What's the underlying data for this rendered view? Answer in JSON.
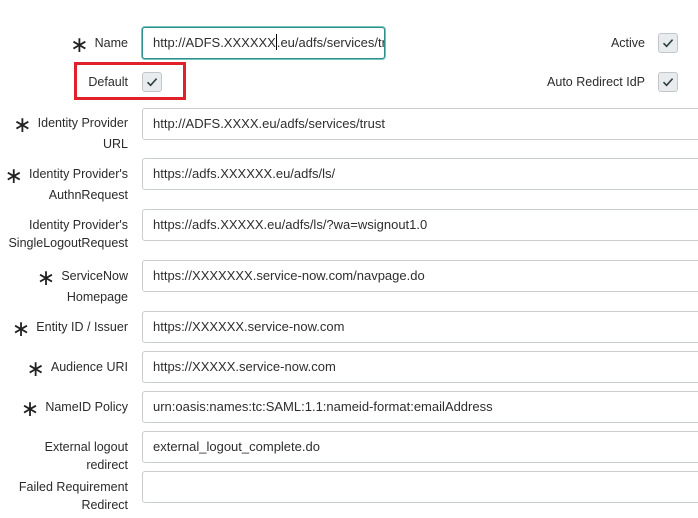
{
  "form": {
    "name": {
      "label": "Name",
      "required": true,
      "value_before_caret": "http://ADFS.XXXXXX",
      "value_after_caret": ".eu/adfs/services/trus"
    },
    "active": {
      "label": "Active",
      "checked": true
    },
    "default": {
      "label": "Default",
      "checked": true
    },
    "auto_redirect": {
      "label": "Auto Redirect IdP",
      "checked": true
    },
    "idp_url": {
      "label_line1": "Identity Provider",
      "label_line2": "URL",
      "required": true,
      "value": "http://ADFS.XXXX.eu/adfs/services/trust"
    },
    "idp_authn": {
      "label_line1": "Identity Provider's",
      "label_line2": "AuthnRequest",
      "required": true,
      "value": "https://adfs.XXXXXX.eu/adfs/ls/"
    },
    "idp_logout": {
      "label_line1": "Identity Provider's",
      "label_line2": "SingleLogoutRequest",
      "required": false,
      "value": "https://adfs.XXXXX.eu/adfs/ls/?wa=wsignout1.0"
    },
    "sn_homepage": {
      "label_line1": "ServiceNow",
      "label_line2": "Homepage",
      "required": true,
      "value": "https://XXXXXXX.service-now.com/navpage.do"
    },
    "entity_id": {
      "label": "Entity ID / Issuer",
      "required": true,
      "value": "https://XXXXXX.service-now.com"
    },
    "audience_uri": {
      "label": "Audience URI",
      "required": true,
      "value": "https://XXXXX.service-now.com"
    },
    "nameid_policy": {
      "label": "NameID Policy",
      "required": true,
      "value": "urn:oasis:names:tc:SAML:1.1:nameid-format:emailAddress"
    },
    "external_logout": {
      "label": "External logout redirect",
      "required": false,
      "value": "external_logout_complete.do"
    },
    "failed_redirect": {
      "label_line1": "Failed Requirement",
      "label_line2": "Redirect",
      "required": false,
      "value": ""
    }
  },
  "icons": {
    "required": "asterisk-icon",
    "check": "checkmark-icon"
  },
  "colors": {
    "focus_border": "#2f8f8a",
    "highlight": "#e0212b",
    "checkbox_bg": "#e9ecee",
    "check": "#2d3e44"
  }
}
